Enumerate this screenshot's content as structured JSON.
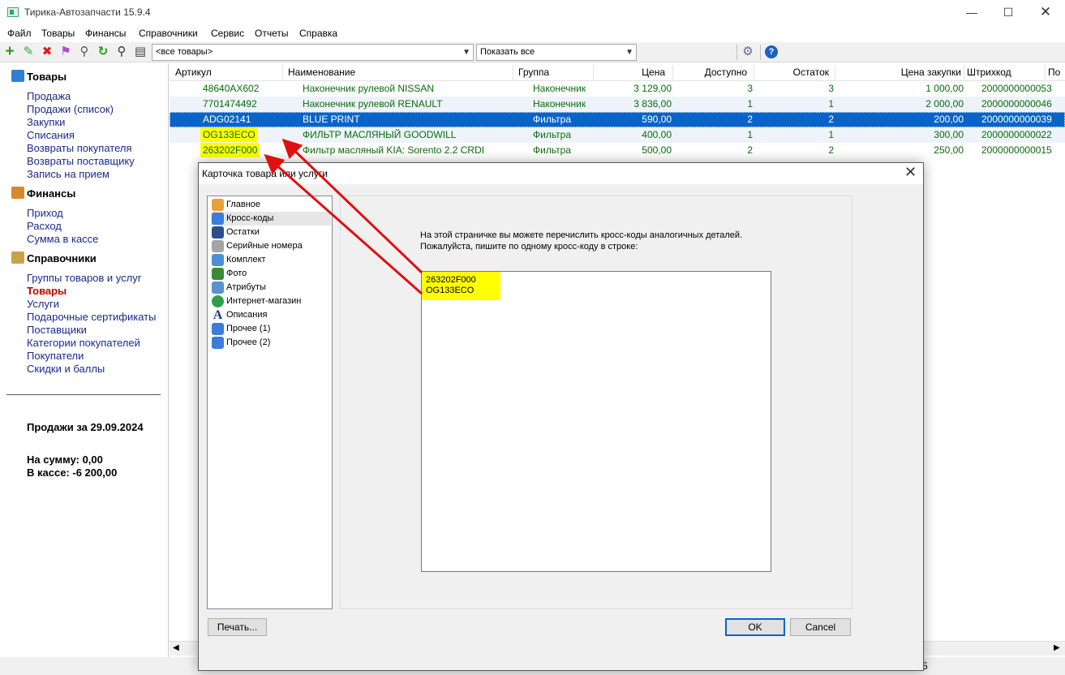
{
  "window": {
    "title": "Тирика-Автозапчасти 15.9.4",
    "min": "—",
    "max": "☐",
    "close": "✕"
  },
  "menu": [
    "Файл",
    "Товары",
    "Финансы",
    "Справочники",
    "Сервис",
    "Отчеты",
    "Справка"
  ],
  "toolbar": {
    "icons": [
      "add-icon",
      "edit-icon",
      "delete-icon",
      "flag-icon",
      "link-icon",
      "refresh-icon",
      "search-icon",
      "print-icon",
      "settings-icon",
      "help-icon"
    ],
    "filter_value": "<все товары>",
    "show_value": "Показать все"
  },
  "sidebar": {
    "goods": {
      "title": "Товары",
      "items": [
        "Продажа",
        "Продажи (список)",
        "Закупки",
        "Списания",
        "Возвраты покупателя",
        "Возвраты поставщику",
        "Запись на прием"
      ]
    },
    "finance": {
      "title": "Финансы",
      "items": [
        "Приход",
        "Расход",
        "Сумма в кассе"
      ]
    },
    "refs": {
      "title": "Справочники",
      "items": [
        "Группы товаров и услуг",
        "Товары",
        "Услуги",
        "Подарочные сертификаты",
        "Поставщики",
        "Категории покупателей",
        "Покупатели",
        "Скидки и баллы"
      ]
    },
    "sales_title": "Продажи за 29.09.2024",
    "sum_line": "На сумму: 0,00",
    "cash_line": "В кассе: -6 200,00"
  },
  "grid": {
    "columns": [
      "Артикул",
      "Наименование",
      "Группа",
      "Цена",
      "Доступно",
      "Остаток",
      "Цена закупки",
      "Штрихкод",
      "По"
    ],
    "rows": [
      [
        "48640AX602",
        "Наконечник рулевой NISSAN",
        "Наконечник",
        "3 129,00",
        "3",
        "3",
        "1 000,00",
        "2000000000053"
      ],
      [
        "7701474492",
        "Наконечник рулевой RENAULT",
        "Наконечник",
        "3 836,00",
        "1",
        "1",
        "2 000,00",
        "2000000000046"
      ],
      [
        "ADG02141",
        "BLUE PRINT",
        "Фильтра",
        "590,00",
        "2",
        "2",
        "200,00",
        "2000000000039"
      ],
      [
        "OG133ECO",
        "ФИЛЬТР МАСЛЯНЫЙ GOODWILL",
        "Фильтра",
        "400,00",
        "1",
        "1",
        "300,00",
        "2000000000022"
      ],
      [
        "263202F000",
        "Фильтр масляный KIA: Sorento 2.2 CRDI",
        "Фильтра",
        "500,00",
        "2",
        "2",
        "250,00",
        "2000000000015"
      ]
    ],
    "selected_row": 2
  },
  "status": {
    "count_text": "5"
  },
  "dialog": {
    "title": "Карточка товара или услуги",
    "close": "✕",
    "nav": [
      "Главное",
      "Кросс-коды",
      "Остатки",
      "Серийные номера",
      "Комплект",
      "Фото",
      "Атрибуты",
      "Интернет-магазин",
      "Описания",
      "Прочее (1)",
      "Прочее (2)"
    ],
    "selected_nav": 1,
    "hint_line1": "На этой страничке вы можете перечислить кросс-коды аналогичных деталей.",
    "hint_line2": "Пожалуйста, пишите по одному кросс-коду в строке:",
    "cross_codes": [
      "263202F000",
      "OG133ECO"
    ],
    "print_button": "Печать...",
    "ok_button": "OK",
    "cancel_button": "Cancel"
  },
  "colors": {
    "link": "#1a2a8c",
    "active": "#d00000",
    "selection": "#0a64c8",
    "row_text": "#0b6b0b",
    "highlight": "#ffff00",
    "arrow": "#e01010"
  }
}
